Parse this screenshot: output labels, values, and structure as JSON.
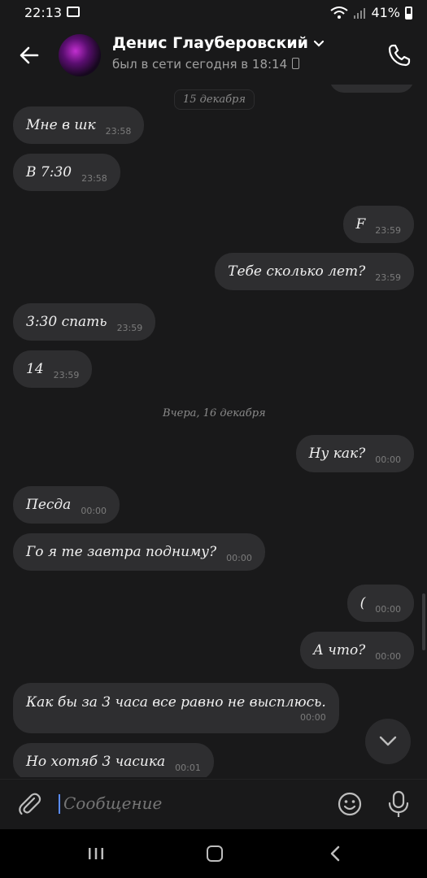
{
  "status_bar": {
    "time": "22:13",
    "battery": "41%"
  },
  "header": {
    "contact_name": "Денис Глауберовский",
    "last_seen": "был в сети сегодня в 18:14"
  },
  "date_separators": [
    "15 декабря",
    "Вчера, 16 декабря"
  ],
  "messages": [
    {
      "side": "in",
      "text": "Мне в шк",
      "time": "23:58"
    },
    {
      "side": "in",
      "text": "В 7:30",
      "time": "23:58"
    },
    {
      "side": "out",
      "text": "F",
      "time": "23:59"
    },
    {
      "side": "out",
      "text": "Тебе сколько лет?",
      "time": "23:59"
    },
    {
      "side": "in",
      "text": "3:30 спать",
      "time": "23:59"
    },
    {
      "side": "in",
      "text": "14",
      "time": "23:59"
    },
    {
      "side": "out",
      "text": "Ну как?",
      "time": "00:00"
    },
    {
      "side": "in",
      "text": "Песда",
      "time": "00:00"
    },
    {
      "side": "in",
      "text": "Го я те завтра подниму?",
      "time": "00:00"
    },
    {
      "side": "out",
      "text": "(",
      "time": "00:00"
    },
    {
      "side": "out",
      "text": "А что?",
      "time": "00:00"
    },
    {
      "side": "in",
      "text": "Как бы за 3 часа все равно не высплюсь.",
      "time": "00:00"
    },
    {
      "side": "in",
      "text": "Но хотяб 3 часика",
      "time": "00:01"
    }
  ],
  "composer": {
    "placeholder": "Сообщение"
  },
  "colors": {
    "background": "#19191a",
    "bubble": "#2e2e30",
    "accent_cursor": "#5a8cff"
  }
}
